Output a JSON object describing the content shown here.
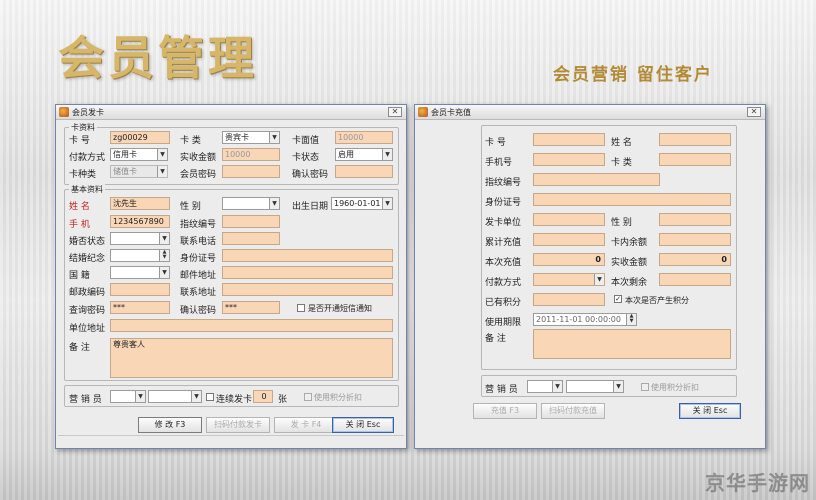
{
  "hero": {
    "title": "会员管理",
    "tagline": "会员营销 留住客户"
  },
  "watermark": "京华手游网",
  "issue_window": {
    "title": "会员发卡",
    "card_group_title": "卡资料",
    "card_no_label": "卡 号",
    "card_no_value": "zg00029",
    "card_type_label": "卡 类",
    "card_type_value": "贵宾卡",
    "face_value_label": "卡面值",
    "face_value_value": "10000",
    "payment_label": "付款方式",
    "payment_value": "信用卡",
    "actual_received_label": "实收金额",
    "actual_received_value": "10000",
    "card_status_label": "卡状态",
    "card_status_value": "启用",
    "card_kind_label": "卡种类",
    "card_kind_value": "储值卡",
    "member_password_label": "会员密码",
    "confirm_password_label": "确认密码",
    "basic_group_title": "基本资料",
    "name_label": "姓 名",
    "name_value": "沈先生",
    "gender_label": "性 别",
    "birthdate_label": "出生日期",
    "birthdate_value": "1960-01-01",
    "mobile_label": "手 机",
    "mobile_value": "1234567890",
    "fingerprint_label": "指纹编号",
    "marital_label": "婚否状态",
    "contact_phone_label": "联系电话",
    "anniversary_label": "结婚纪念",
    "id_number_label": "身份证号",
    "nationality_label": "国 籍",
    "email_label": "邮件地址",
    "postcode_label": "邮政编码",
    "contact_address_label": "联系地址",
    "query_password_label": "查询密码",
    "query_password_value": "***",
    "confirm_password2_label": "确认密码",
    "confirm_password2_value": "***",
    "sms_notify_label": "是否开通短信通知",
    "company_address_label": "单位地址",
    "remarks_label": "备 注",
    "remarks_value": "尊贵客人",
    "salesperson_label": "营 销 员",
    "continuous_issue_label": "连续发卡",
    "continuous_issue_value": "0",
    "sheets_label": "张",
    "use_points_label": "使用积分折扣",
    "modify_button": "修 改 F3",
    "scan_pay_button": "扫码付款发卡",
    "issue_button": "发 卡 F4",
    "close_button": "关 闭 Esc"
  },
  "recharge_window": {
    "title": "会员卡充值",
    "card_no_label": "卡 号",
    "name_label": "姓 名",
    "mobile_label": "手机号",
    "card_type_label": "卡 类",
    "fingerprint_label": "指纹编号",
    "id_number_label": "身份证号",
    "issue_unit_label": "发卡单位",
    "gender_label": "性 别",
    "total_recharge_label": "累计充值",
    "card_balance_label": "卡内余额",
    "current_recharge_label": "本次充值",
    "current_recharge_value": "0",
    "actual_received_label": "实收金额",
    "actual_received_value": "0",
    "payment_label": "付款方式",
    "remaining_times_label": "本次剩余",
    "points_label": "已有积分",
    "generate_points_label": "本次是否产生积分",
    "validity_label": "使用期限",
    "validity_value": "2011-11-01 00:00:00",
    "remarks_label": "备 注",
    "salesperson_label": "营 销 员",
    "use_points_label": "使用积分折扣",
    "recharge_button": "充值 F3",
    "scan_pay_button": "扫码付款充值",
    "close_button": "关 闭 Esc"
  },
  "colors": {
    "field_fill": "#f9d6b6",
    "hero_gold": "#d6b76a",
    "window_border": "#6f86a8"
  }
}
